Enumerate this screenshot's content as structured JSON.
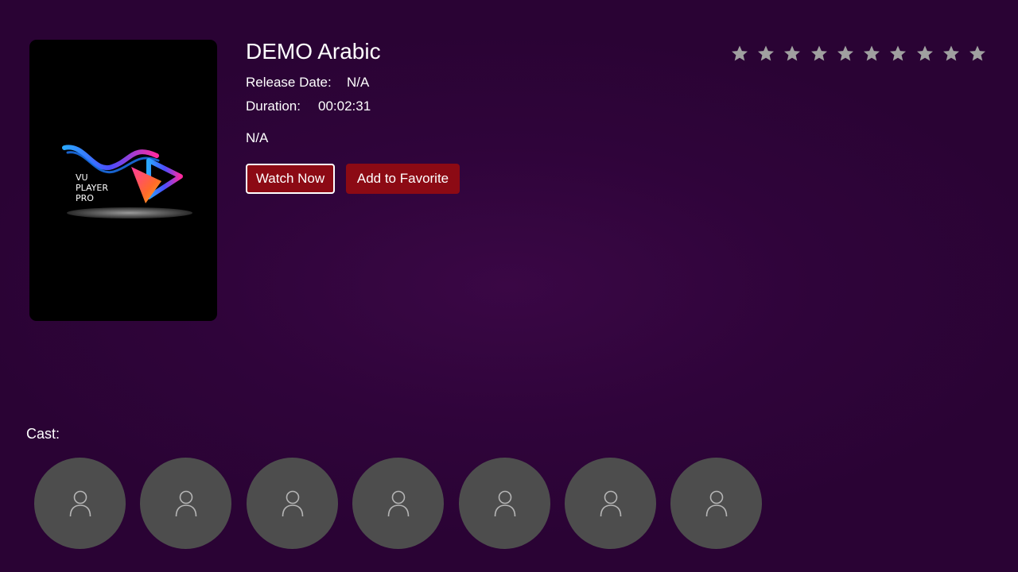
{
  "movie": {
    "title": "DEMO Arabic",
    "release_label": "Release Date:",
    "release_value": "N/A",
    "duration_label": "Duration:",
    "duration_value": "00:02:31",
    "description": "N/A",
    "poster_logo_text": [
      "VU",
      "PLAYER",
      "PRO"
    ]
  },
  "actions": {
    "watch_label": "Watch Now",
    "favorite_label": "Add to Favorite"
  },
  "rating": {
    "max": 10,
    "filled": 0,
    "star_color": "#a0a0a0"
  },
  "cast": {
    "label": "Cast:",
    "members": [
      {
        "icon": "person-icon"
      },
      {
        "icon": "person-icon"
      },
      {
        "icon": "person-icon"
      },
      {
        "icon": "person-icon"
      },
      {
        "icon": "person-icon"
      },
      {
        "icon": "person-icon"
      },
      {
        "icon": "person-icon"
      }
    ]
  },
  "colors": {
    "background": "#2f043a",
    "button": "#8c0a14",
    "cast_circle": "#4d4d4d"
  }
}
